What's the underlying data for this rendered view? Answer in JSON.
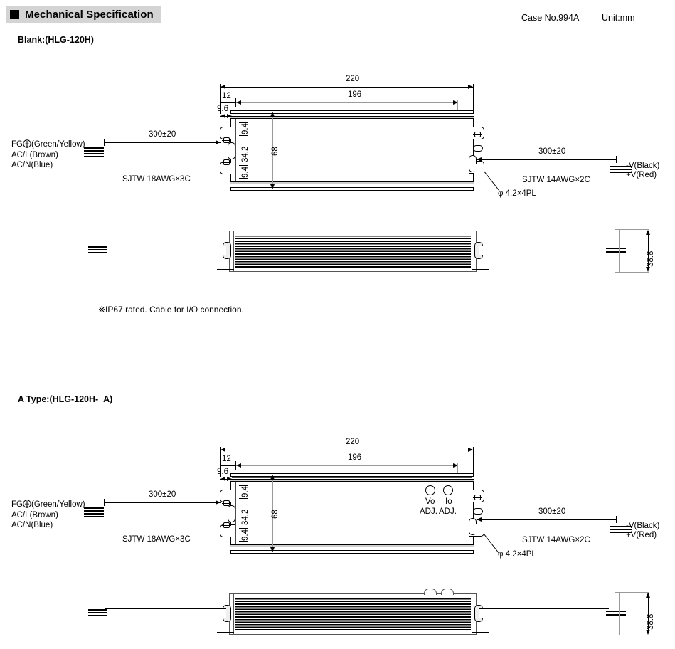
{
  "header": {
    "bullet_icon": "filled-square-icon",
    "title": "Mechanical Specification",
    "case_no": "Case No.994A",
    "unit": "Unit:mm"
  },
  "blank_type": {
    "label": "Blank:(HLG-120H)",
    "note": "※IP67 rated. Cable for I/O connection.",
    "dimensions": {
      "overall_length": "220",
      "body_length": "196",
      "edge_offset": "12",
      "tab_offset": "9.6",
      "tab_top": "9.4",
      "tab_bottom": "9.4",
      "inner_width": "34.2",
      "overall_width": "68",
      "height": "38.8"
    },
    "input_cable": {
      "length": "300±20",
      "spec": "SJTW 18AWG×3C",
      "wires": [
        "FG⏚(Green/Yellow)",
        "AC/L(Brown)",
        "AC/N(Blue)"
      ],
      "fg_prefix": "FG",
      "fg_icon": "earth-ground-icon",
      "fg_suffix": "(Green/Yellow)",
      "wire_l": "AC/L(Brown)",
      "wire_n": "AC/N(Blue)"
    },
    "output_cable": {
      "length": "300±20",
      "spec": "SJTW 14AWG×2C",
      "neg": "-V(Black)",
      "pos": "+V(Red)"
    },
    "hole_callout": "φ 4.2×4PL"
  },
  "a_type": {
    "label": "A Type:(HLG-120H-_A)",
    "dimensions": {
      "overall_length": "220",
      "body_length": "196",
      "edge_offset": "12",
      "tab_offset": "9.6",
      "tab_top": "9.4",
      "tab_bottom": "9.4",
      "inner_width": "34.2",
      "overall_width": "68",
      "height": "38.8"
    },
    "input_cable": {
      "length": "300±20",
      "spec": "SJTW 18AWG×3C",
      "fg_prefix": "FG",
      "fg_suffix": "(Green/Yellow)",
      "wire_l": "AC/L(Brown)",
      "wire_n": "AC/N(Blue)"
    },
    "output_cable": {
      "length": "300±20",
      "spec": "SJTW 14AWG×2C",
      "neg": "-V(Black)",
      "pos": "+V(Red)"
    },
    "hole_callout": "φ 4.2×4PL",
    "adjusters": [
      {
        "name": "Vo",
        "sub": "ADJ."
      },
      {
        "name": "Io",
        "sub": "ADJ."
      }
    ],
    "adj_vo_name": "Vo",
    "adj_vo_sub": "ADJ.",
    "adj_io_name": "Io",
    "adj_io_sub": "ADJ."
  },
  "colors": {
    "ink": "#000000",
    "header_bg": "#d4d4d4",
    "shell_gray": "#e8e8e8",
    "dim_line": "#000000"
  }
}
